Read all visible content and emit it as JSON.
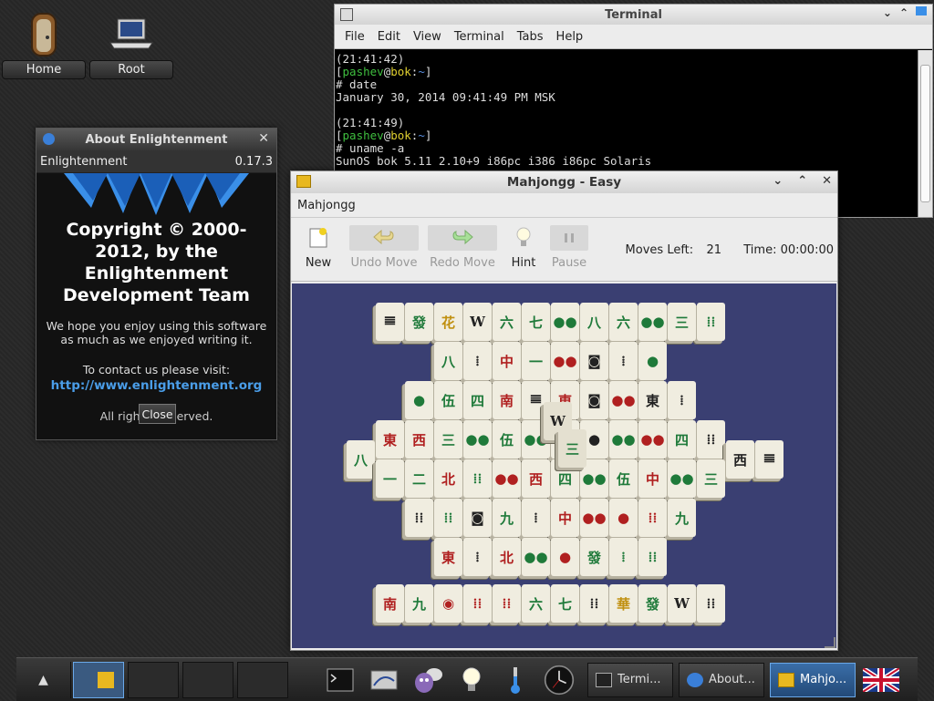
{
  "desktop": {
    "icons": [
      {
        "label": "Home"
      },
      {
        "label": "Root"
      }
    ]
  },
  "terminal": {
    "title": "Terminal",
    "menu": [
      "File",
      "Edit",
      "View",
      "Terminal",
      "Tabs",
      "Help"
    ],
    "lines": [
      {
        "time": "(21:41:42)"
      },
      {
        "user": "pashev",
        "host": "bok",
        "dir": "~"
      },
      {
        "cmd": "# date"
      },
      {
        "out": "January 30, 2014 09:41:49 PM MSK"
      },
      {
        "time": "(21:41:49)"
      },
      {
        "user": "pashev",
        "host": "bok",
        "dir": "~"
      },
      {
        "cmd": "# uname -a"
      },
      {
        "out": "SunOS bok 5.11 2.10+9 i86pc i386 i86pc Solaris"
      }
    ]
  },
  "about": {
    "title": "About Enlightenment",
    "app_name": "Enlightenment",
    "version": "0.17.3",
    "copyright": "Copyright © 2000-2012, by the Enlightenment Development Team",
    "message": "We hope you enjoy using this software as much as we enjoyed writing it.",
    "contact": "To contact us please visit:",
    "url": "http://www.enlightenment.org",
    "rights_left": "All righ",
    "rights_right": "erved.",
    "close_label": "Close"
  },
  "mahjongg": {
    "title": "Mahjongg - Easy",
    "menu": "Mahjongg",
    "toolbar": {
      "new": "New",
      "undo": "Undo Move",
      "redo": "Redo Move",
      "hint": "Hint",
      "pause": "Pause"
    },
    "moves_label": "Moves Left:",
    "moves_left": "21",
    "time_label": "Time:",
    "time": "00:00:00",
    "tiles": [
      {
        "g": "𝍣",
        "c": "t-blk"
      },
      {
        "g": "發",
        "c": "t-green"
      },
      {
        "g": "花",
        "c": "t-gold"
      },
      {
        "g": "W",
        "c": "t-blk"
      },
      {
        "g": "六",
        "c": "t-green"
      },
      {
        "g": "七",
        "c": "t-green"
      },
      {
        "g": "●●",
        "c": "t-green"
      },
      {
        "g": "八",
        "c": "t-green"
      },
      {
        "g": "六",
        "c": "t-green"
      },
      {
        "g": "●●",
        "c": "t-green"
      },
      {
        "g": "三",
        "c": "t-green"
      },
      {
        "g": "⁞⁞",
        "c": "t-green"
      },
      {
        "g": "八",
        "c": "t-green"
      },
      {
        "g": "⁞",
        "c": "t-blk"
      },
      {
        "g": "中",
        "c": "t-red"
      },
      {
        "g": "一",
        "c": "t-green"
      },
      {
        "g": "●●",
        "c": "t-red"
      },
      {
        "g": "◙",
        "c": "t-blk"
      },
      {
        "g": "⁞",
        "c": "t-blk"
      },
      {
        "g": "●",
        "c": "t-green"
      },
      {
        "g": "●",
        "c": "t-green"
      },
      {
        "g": "伍",
        "c": "t-green"
      },
      {
        "g": "四",
        "c": "t-green"
      },
      {
        "g": "南",
        "c": "t-red"
      },
      {
        "g": "𝍣",
        "c": "t-blk"
      },
      {
        "g": "東",
        "c": "t-red"
      },
      {
        "g": "◙",
        "c": "t-blk"
      },
      {
        "g": "●●",
        "c": "t-red"
      },
      {
        "g": "東",
        "c": "t-blk"
      },
      {
        "g": "⁞",
        "c": "t-blk"
      },
      {
        "g": "東",
        "c": "t-red"
      },
      {
        "g": "西",
        "c": "t-red"
      },
      {
        "g": "三",
        "c": "t-green"
      },
      {
        "g": "●●",
        "c": "t-green"
      },
      {
        "g": "伍",
        "c": "t-green"
      },
      {
        "g": "●●",
        "c": "t-green"
      },
      {
        "g": "◉",
        "c": "t-green"
      },
      {
        "g": "●",
        "c": "t-blk"
      },
      {
        "g": "●●",
        "c": "t-green"
      },
      {
        "g": "●●",
        "c": "t-red"
      },
      {
        "g": "四",
        "c": "t-green"
      },
      {
        "g": "⁞⁞",
        "c": "t-blk"
      },
      {
        "g": "一",
        "c": "t-green"
      },
      {
        "g": "二",
        "c": "t-green"
      },
      {
        "g": "北",
        "c": "t-red"
      },
      {
        "g": "⁞⁞",
        "c": "t-green"
      },
      {
        "g": "●●",
        "c": "t-red"
      },
      {
        "g": "西",
        "c": "t-red"
      },
      {
        "g": "四",
        "c": "t-green"
      },
      {
        "g": "●●",
        "c": "t-green"
      },
      {
        "g": "伍",
        "c": "t-green"
      },
      {
        "g": "中",
        "c": "t-red"
      },
      {
        "g": "●●",
        "c": "t-green"
      },
      {
        "g": "三",
        "c": "t-green"
      },
      {
        "g": "⁞⁞",
        "c": "t-blk"
      },
      {
        "g": "⁞⁞",
        "c": "t-green"
      },
      {
        "g": "◙",
        "c": "t-blk"
      },
      {
        "g": "九",
        "c": "t-green"
      },
      {
        "g": "⁞",
        "c": "t-blk"
      },
      {
        "g": "中",
        "c": "t-red"
      },
      {
        "g": "●●",
        "c": "t-red"
      },
      {
        "g": "●",
        "c": "t-red"
      },
      {
        "g": "⁞⁞",
        "c": "t-red"
      },
      {
        "g": "九",
        "c": "t-green"
      },
      {
        "g": "東",
        "c": "t-red"
      },
      {
        "g": "⁞",
        "c": "t-blk"
      },
      {
        "g": "北",
        "c": "t-red"
      },
      {
        "g": "●●",
        "c": "t-green"
      },
      {
        "g": "●",
        "c": "t-red"
      },
      {
        "g": "發",
        "c": "t-green"
      },
      {
        "g": "⁞",
        "c": "t-green"
      },
      {
        "g": "⁞⁞",
        "c": "t-green"
      },
      {
        "g": "南",
        "c": "t-red"
      },
      {
        "g": "九",
        "c": "t-green"
      },
      {
        "g": "◉",
        "c": "t-red"
      },
      {
        "g": "⁞⁞",
        "c": "t-red"
      },
      {
        "g": "⁞⁞",
        "c": "t-red"
      },
      {
        "g": "六",
        "c": "t-green"
      },
      {
        "g": "七",
        "c": "t-green"
      },
      {
        "g": "⁞⁞",
        "c": "t-blk"
      },
      {
        "g": "華",
        "c": "t-gold"
      },
      {
        "g": "發",
        "c": "t-green"
      },
      {
        "g": "W",
        "c": "t-blk"
      },
      {
        "g": "⁞⁞",
        "c": "t-blk"
      },
      {
        "g": "八",
        "c": "t-green"
      },
      {
        "g": "西",
        "c": "t-blk"
      }
    ]
  },
  "taskbar": {
    "tasks": [
      {
        "label": "Termi..."
      },
      {
        "label": "About..."
      },
      {
        "label": "Mahjo..."
      }
    ]
  },
  "colors": {
    "board": "#3a3f72",
    "tile_face": "#f0ede0",
    "link": "#4a9de8",
    "task_active": "#3a6ea8"
  }
}
